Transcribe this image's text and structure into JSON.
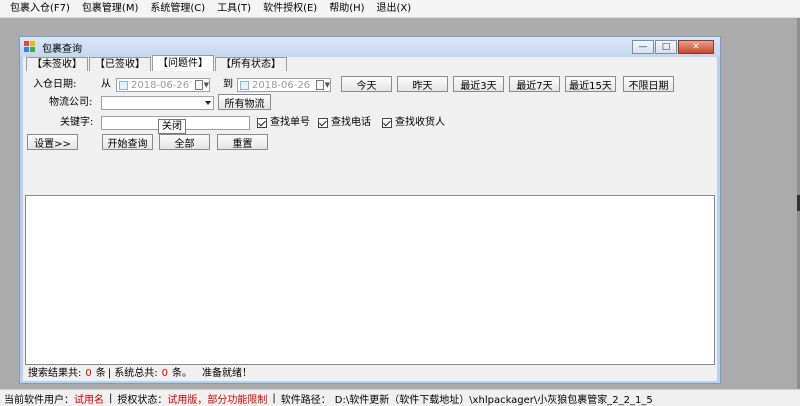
{
  "menu": [
    "包裹入仓(F7)",
    "包裹管理(M)",
    "系统管理(C)",
    "工具(T)",
    "软件授权(E)",
    "帮助(H)",
    "退出(X)"
  ],
  "window": {
    "title": "包裹查询",
    "controls": {
      "minimize": "—",
      "maximize": "□",
      "close": "✕"
    }
  },
  "tabs": [
    "【未签收】",
    "【已签收】",
    "【问题件】",
    "【所有状态】"
  ],
  "active_tab_index": 2,
  "filters": {
    "date_label": "入仓日期:",
    "from_label": "从",
    "from_date": "2018-06-26",
    "to_label": "到",
    "to_date": "2018-06-26",
    "quick_dates": [
      "今天",
      "昨天",
      "最近3天",
      "最近7天",
      "最近15天",
      "不限日期"
    ],
    "logistics_label": "物流公司:",
    "logistics_value": "",
    "all_logistics_button": "所有物流",
    "keyword_label": "关键字:",
    "keyword_value": "",
    "checkboxes": [
      {
        "label": "查找单号",
        "checked": true
      },
      {
        "label": "查找电话",
        "checked": true
      },
      {
        "label": "查找收货人",
        "checked": true
      }
    ]
  },
  "actions": {
    "settings": "设置>>",
    "start_query": "开始查询",
    "all": "全部",
    "reset": "重置"
  },
  "tooltip": "关闭",
  "result_status": {
    "total_label": "搜索结果共:",
    "total_count": "0",
    "unit1": "条",
    "system_label": "| 系统总共:",
    "system_count": "0",
    "unit2": "条。",
    "ready": "准备就绪！"
  },
  "statusbar": {
    "user_label": "当前软件用户：",
    "user_value": "试用名",
    "auth_label": "授权状态：",
    "auth_value": "试用版，部分功能限制",
    "path_label": "软件路径：",
    "path_value": "D:\\软件更新（软件下载地址）\\xhlpackager\\小灰狼包裹管家_2_2_1_5"
  },
  "colors": {
    "workspace_bg": "#ababab",
    "window_border": "#b9d1ea",
    "close_button": "#c7452c",
    "status_red": "#e00000"
  }
}
